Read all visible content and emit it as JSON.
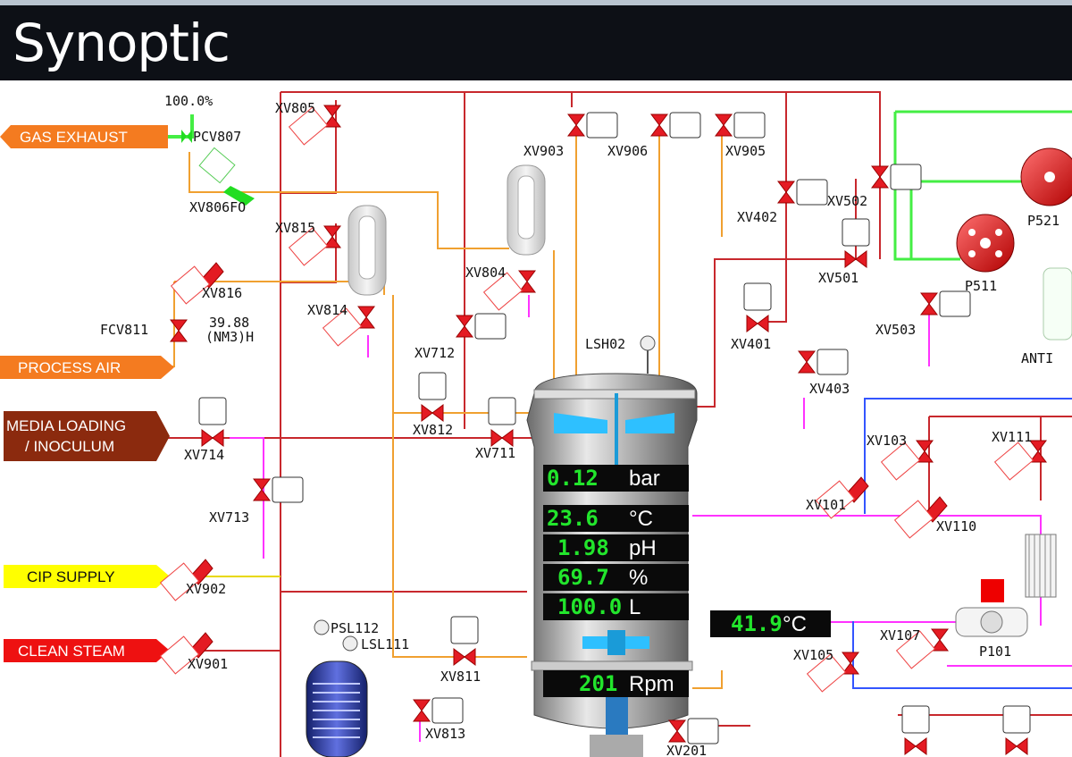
{
  "header": {
    "title": "Synoptic"
  },
  "colors": {
    "header_bg": "#0d1016",
    "readout_value": "#22e52c",
    "valve_red": "#e41b23",
    "pipe_red": "#c8282d",
    "pipe_orange": "#f0a030",
    "pipe_magenta": "#ff33ff",
    "pipe_green": "#44ee44",
    "pipe_blue": "#3355ff"
  },
  "sources": {
    "gas_exhaust": "GAS EXHAUST",
    "process_air": "PROCESS AIR",
    "media_loading_1": "MEDIA LOADING",
    "media_loading_2": "/ INOCULUM",
    "cip_supply": "CIP SUPPLY",
    "clean_steam": "CLEAN STEAM"
  },
  "instruments": {
    "pcv807_pct": "100.0%",
    "pcv807": "PCV807",
    "xv806fo": "XV806FO",
    "xv816": "XV816",
    "fcv811": "FCV811",
    "fcv811_val": "39.88",
    "fcv811_unit": "(NM3)H",
    "xv805": "XV805",
    "xv815": "XV815",
    "xv814": "XV814",
    "xv804": "XV804",
    "xv903": "XV903",
    "xv906": "XV906",
    "xv905": "XV905",
    "xv402": "XV402",
    "xv502": "XV502",
    "xv501": "XV501",
    "xv503": "XV503",
    "xv401": "XV401",
    "xv403": "XV403",
    "xv712": "XV712",
    "xv812": "XV812",
    "xv711": "XV711",
    "xv714": "XV714",
    "xv713": "XV713",
    "xv902": "XV902",
    "xv901": "XV901",
    "psl112": "PSL112",
    "lsl111": "LSL111",
    "xv811": "XV811",
    "xv813": "XV813",
    "lsh02": "LSH02",
    "xv201": "XV201",
    "xv103": "XV103",
    "xv111": "XV111",
    "xv101": "XV101",
    "xv110": "XV110",
    "xv105": "XV105",
    "xv107": "XV107",
    "p101": "P101",
    "p511": "P511",
    "p521": "P521",
    "anti": "ANTI"
  },
  "readouts": {
    "pressure": {
      "value": "0.12",
      "unit": "bar"
    },
    "temperature": {
      "value": "23.6",
      "unit": "°C"
    },
    "ph": {
      "value": "1.98",
      "unit": "pH"
    },
    "do2": {
      "value": "69.7",
      "unit": "%"
    },
    "volume": {
      "value": "100.0",
      "unit": "L"
    },
    "agitation": {
      "value": "201",
      "unit": "Rpm"
    },
    "jacket_temp": {
      "value": "41.9",
      "unit": "°C"
    }
  }
}
